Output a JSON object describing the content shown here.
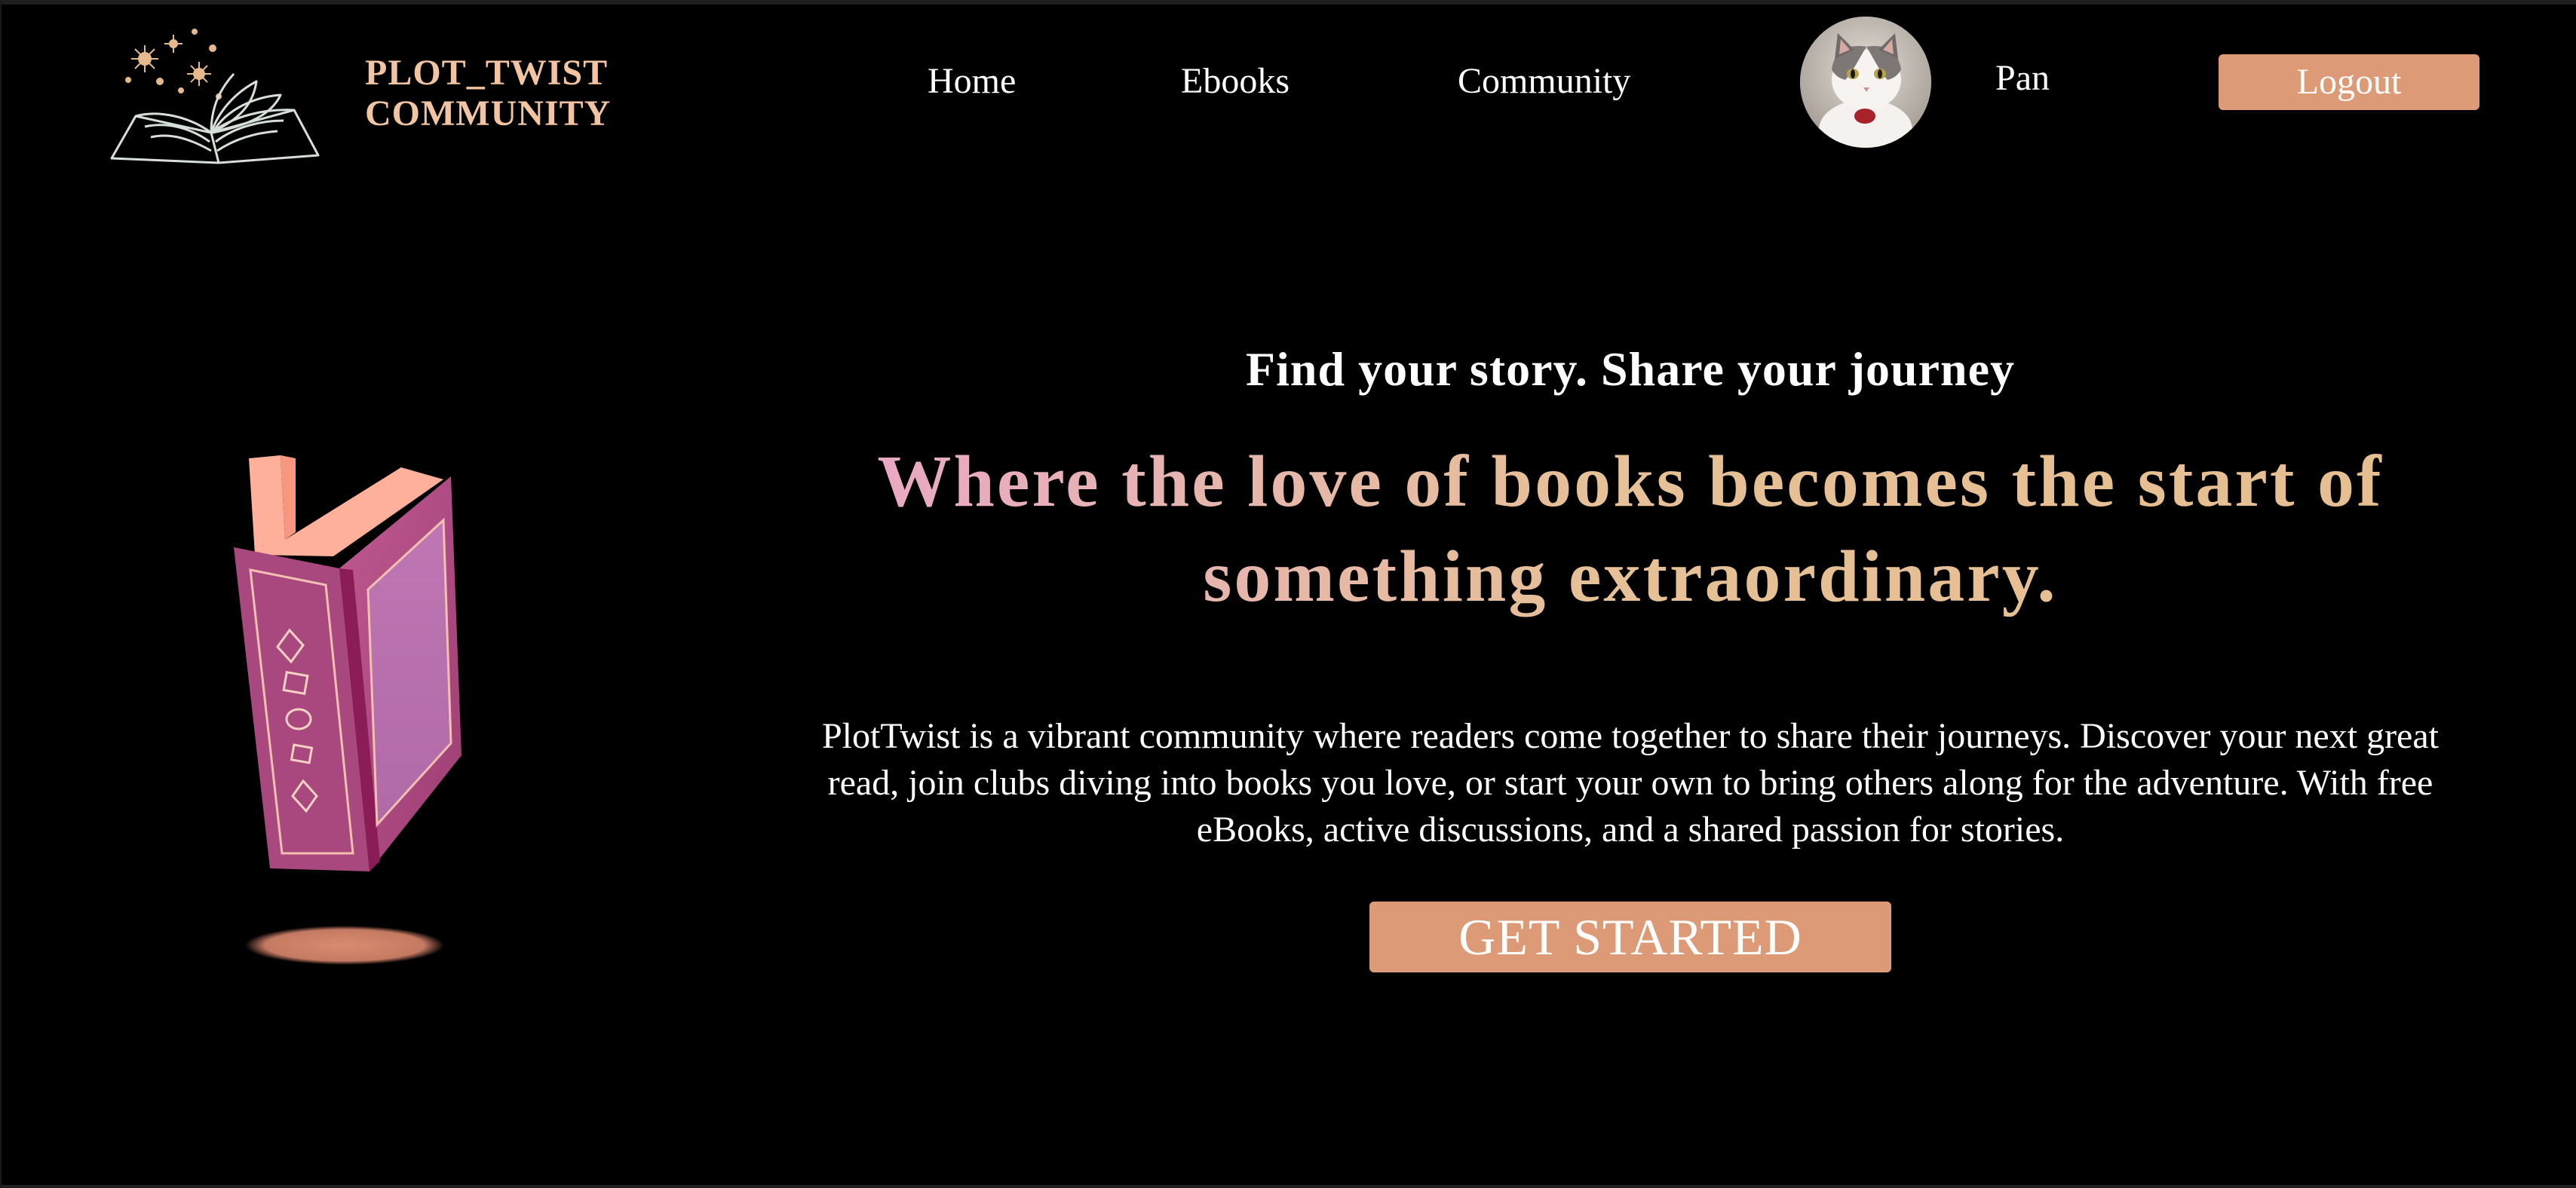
{
  "navbar": {
    "brand_line1": "PLOT_TWIST",
    "brand_line2": "COMMUNITY",
    "links": [
      {
        "label": "Home"
      },
      {
        "label": "Ebooks"
      },
      {
        "label": "Community"
      }
    ],
    "user": {
      "name": "Pan",
      "avatar_icon": "cat-avatar-icon"
    },
    "logout_label": "Logout"
  },
  "hero": {
    "tagline": "Find your story. Share your journey",
    "headline": "Where the love of books becomes the start of something extraordinary.",
    "description": "PlotTwist is a vibrant community where readers come together to share their journeys. Discover your next great read, join clubs diving into books you love, or start your own to bring others along for the adventure. With free eBooks, active discussions, and a shared passion for stories.",
    "cta_label": "GET STARTED",
    "illustration_icon": "floating-book-icon"
  },
  "colors": {
    "background": "#000000",
    "brand": "#f2c4a2",
    "accent_button": "#dd9a76",
    "headline_gradient_start": "#eaa6c8",
    "headline_gradient_end": "#e5bf90",
    "book_cover": "#b04f86",
    "book_pages": "#ffb09a"
  }
}
